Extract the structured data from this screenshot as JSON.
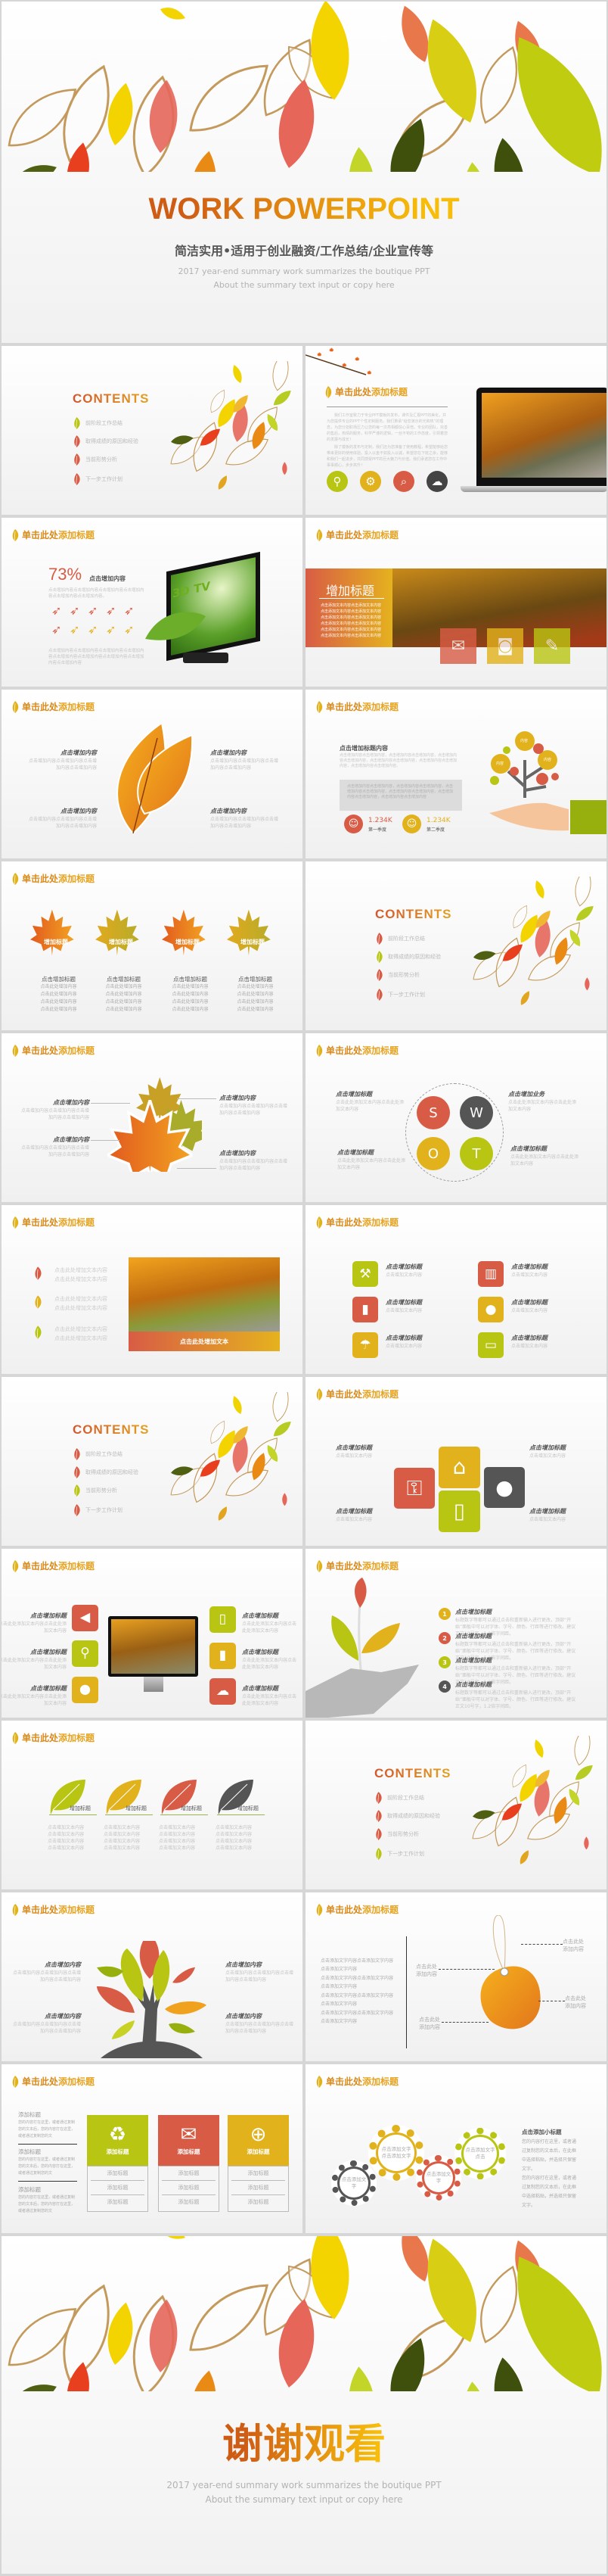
{
  "colors": {
    "red": "#d85c45",
    "orange": "#e07a22",
    "yellow": "#e2b21c",
    "green": "#b9c513",
    "dark": "#555555"
  },
  "slide_title": {
    "part1": "单击此处",
    "part2": "添加标题"
  },
  "cover": {
    "title": "WORK POWERPOINT",
    "subtitle": "简洁实用•适用于创业融资/工作总结/企业宣传等",
    "desc1": "2017 year-end summary work summarizes the boutique PPT",
    "desc2": "About the summary text input or copy here"
  },
  "contents": {
    "heading": "CONTENTS",
    "items": [
      "前阶段工作总结",
      "取得成绩的原因和经验",
      "当前形势分析",
      "下一步工作计划"
    ]
  },
  "ph": {
    "add_content": "点击增加内容",
    "add_title": "点击增加标题",
    "add_title2": "点击添加标题",
    "title_short": "增加标题",
    "add_here": "点击此处增加内容",
    "add_text_here": "点击此处增加文本内容",
    "add_text": "点击此处增加文本",
    "body": "点击增加内容点击增加内容点击增加内容点击增加内容",
    "body2": "点击此处添加文本内容点击此处添加文本内容",
    "text_content": "点击增加文本内容",
    "add_here2": "点击此处添加内容",
    "add_word": "点击添加文字内容点击添加文字内容点击添加文字内容",
    "stack": "添加标题",
    "stack_body": "您的内容打在这里，或者通过复制您的文本后，您的内容打在这里，或者通过复制您的文"
  },
  "intro": {
    "p1": "我们工作室致力于专业PPT模板的发布，课件及汇报PPT的美化，并为您提供专业的PPT个性定制服务。我们秉承“给您演示的光和热”的理念，为您分担职场压力让您的每一次亮相都信心百倍。专业的团队，完善的售后，热情的服务，科学严谨的逻辑，一丝不苟的工作态度，引领着您的发展与成长！",
    "p2": "除了模板的发布与定制，我们还为您准备了使用教程，希望能够给您带来更好的使用体验。投入以金不如投入以诚，希望您在下班之余，能够和我们一起进步，共同感受PPT的巨大魅力与价值。我们承诺您在工作中事事顺心，步步高升！",
    "icons": [
      "location-icon",
      "gear-icon",
      "search-icon",
      "cloud-icon"
    ]
  },
  "tv": {
    "percent": "73%",
    "label": "点击增加内容",
    "screen_text": "3D TV",
    "rockets_total": 10,
    "rockets_filled": 6,
    "body": "点击增加内容点击增加内容点击增加内容点击增加内容点击增加内容点击增加内容。",
    "body2": "点击增加内容点击增加内容点击增加内容点击增加内容点击增加内容点击增加内容点击增加内容点击增加内容点击增加内容"
  },
  "banner": {
    "title": "增加标题",
    "line": "点击添加文本内容点击添加文本内容",
    "icons": [
      "mail-icon",
      "camera-icon",
      "pencil-icon"
    ]
  },
  "stats": {
    "heading": "点击增加标题内容",
    "body": "点击增加内容点击增加内容，点击增加内容点击增加内容，点击增加内容点击增加内容，点击增加内容点击增加内容，点击增加内容点击增加内容，点击增加内容点击增加内容。",
    "box": "点击增加内容点击增加内容，点击增加内容点击增加内容，点击增加内容点击增加内容，点击增加内容点击增加内容，点击增加内容点击增加内容，点击增加内容点击增加内容",
    "items": [
      {
        "value": "1.234K",
        "label": "第一季度"
      },
      {
        "value": "1.234K",
        "label": "第二季度"
      }
    ],
    "bubble": "内容"
  },
  "swot": [
    "S",
    "W",
    "O",
    "T"
  ],
  "swot_labels": [
    "点击增加标题",
    "点击增加业务",
    "点击增加标题",
    "点击增加标题"
  ],
  "steps": [
    "1",
    "2",
    "3",
    "4"
  ],
  "steps_body": "标题数字等都可以通过点击和重新输入进行更改，顶部“开始”面板中可以对字体、字号、颜色、行距等进行修改。建议正文10号字，1.2倍字间距。",
  "tag_callout": "点击此处添加内容",
  "gear": {
    "dark": "点击添加文字",
    "yellow": "点击添加文字点击添加文字",
    "red": "点击添加文字",
    "green": "点击添加文字点击",
    "heading": "点击添加小标题",
    "body": "您的内容打在这里，或者通过复制您的文本后，在此框中选择粘贴，并选择只保留文字。"
  },
  "thanks": {
    "title": "谢谢观看",
    "desc1": "2017 year-end summary work summarizes the boutique PPT",
    "desc2": "About the summary text input or copy here"
  }
}
